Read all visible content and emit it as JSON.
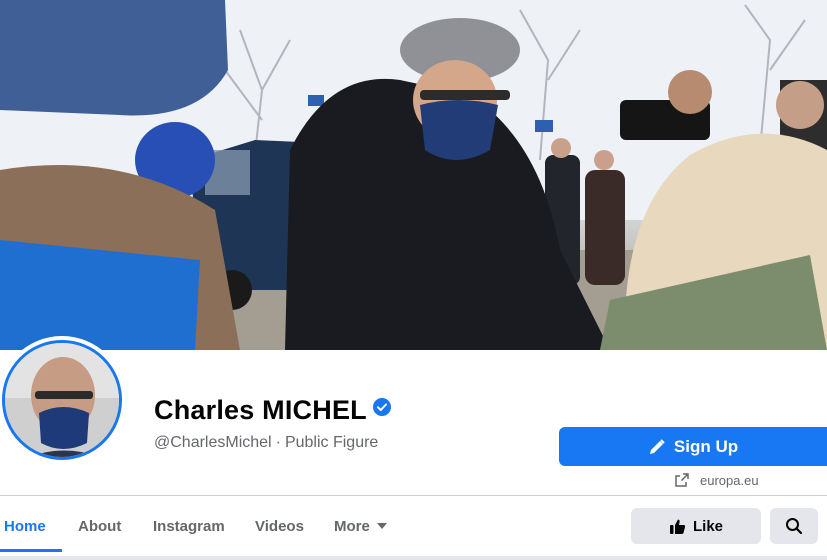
{
  "profile": {
    "name": "Charles MICHEL",
    "handle": "@CharlesMichel",
    "separator": "·",
    "category": "Public Figure",
    "verified": true
  },
  "actions": {
    "signup_label": "Sign Up",
    "website": "europa.eu",
    "like_label": "Like"
  },
  "nav": {
    "tabs": [
      {
        "label": "Home",
        "active": true
      },
      {
        "label": "About",
        "active": false
      },
      {
        "label": "Instagram",
        "active": false
      },
      {
        "label": "Videos",
        "active": false
      },
      {
        "label": "More",
        "active": false
      }
    ]
  },
  "colors": {
    "accent": "#1877f2",
    "secondary_text": "#65676b",
    "button_gray": "#e4e6eb"
  },
  "icons": {
    "verified": "verified-check-icon",
    "signup": "pencil-icon",
    "website": "external-link-icon",
    "like": "thumbs-up-icon",
    "search": "search-icon",
    "more": "caret-down-icon"
  }
}
